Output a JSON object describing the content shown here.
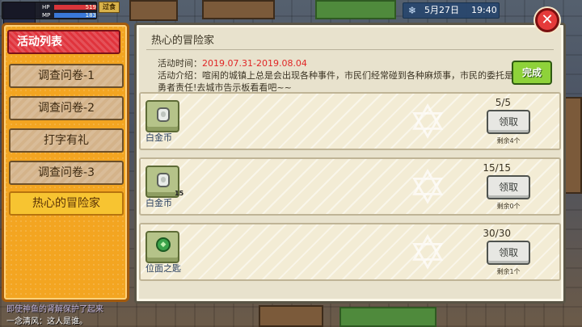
{
  "hud": {
    "hp_label": "HP",
    "hp_value": "519",
    "mp_label": "MP",
    "mp_value": "183",
    "level_badge": "过食",
    "date": "5月27日",
    "time": "19:40"
  },
  "tabs": {
    "header": "活动列表",
    "items": [
      {
        "label": "调查问卷-1"
      },
      {
        "label": "调查问卷-2"
      },
      {
        "label": "打字有礼"
      },
      {
        "label": "调查问卷-3"
      },
      {
        "label": "热心的冒险家"
      }
    ],
    "selected_index": 4
  },
  "panel": {
    "title": "热心的冒险家",
    "time_label": "活动时间：",
    "time_value": "2019.07.31-2019.08.04",
    "intro_label": "活动介绍：",
    "intro_text": "喧闹的城镇上总是会出现各种事件，市民们经常碰到各种麻烦事，市民的委托是勇者责任!去城市告示板看看吧~~",
    "complete_label": "完成",
    "close_label": "✕"
  },
  "rewards": [
    {
      "name": "白金币",
      "count": "",
      "progress": "5/5",
      "button": "领取",
      "remain": "剩余4个",
      "icon": "platinum-coin-icon"
    },
    {
      "name": "白金币",
      "count": "15",
      "progress": "15/15",
      "button": "领取",
      "remain": "剩余0个",
      "icon": "platinum-coin-icon"
    },
    {
      "name": "位面之匙",
      "count": "",
      "progress": "30/30",
      "button": "领取",
      "remain": "剩余1个",
      "icon": "plane-key-icon"
    }
  ],
  "chat": {
    "line1": "即使神鱼的肾解保护了起来",
    "line2": "一念清风：这人是谁。"
  },
  "colors": {
    "tab_frame": "#f3a521",
    "tab_active_head": "#e0333c",
    "complete_button": "#8ed23a",
    "close_button": "#e53a3a",
    "date_red": "#e02626"
  }
}
